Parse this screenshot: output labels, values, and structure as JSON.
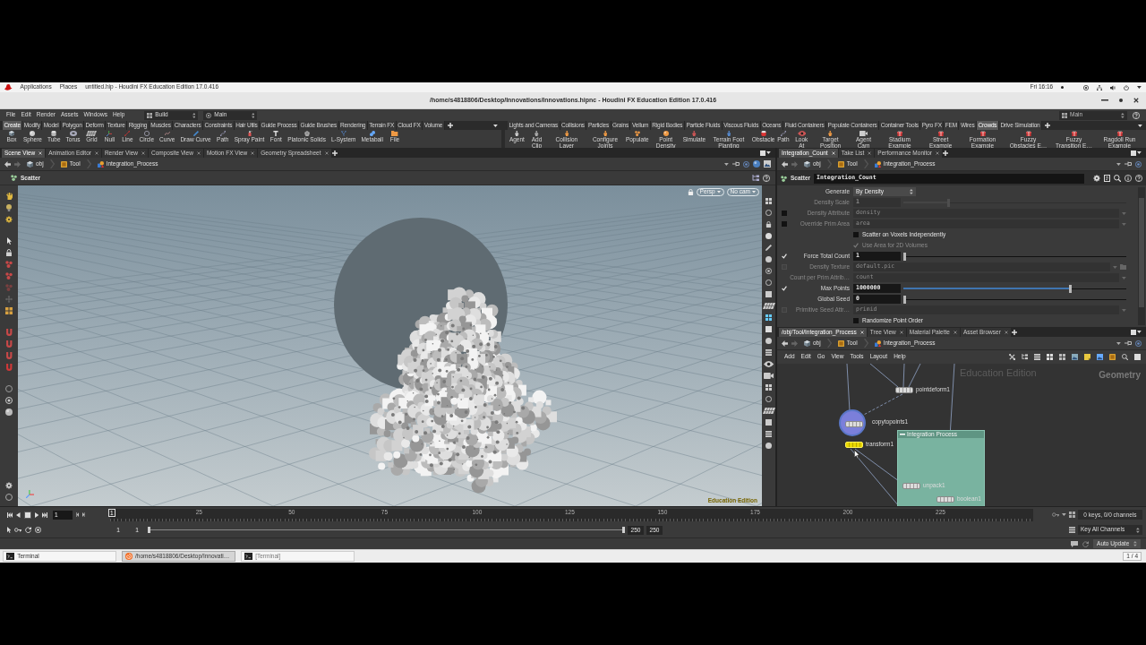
{
  "top_bar": {
    "menus": [
      "Applications",
      "Places"
    ],
    "active_window": "untitled.hip - Houdini FX Education Edition 17.0.416",
    "clock": "Fri 16:16"
  },
  "window": {
    "title": "/home/s4818806/Desktop/Innovations/Innovations.hipnc - Houdini FX Education Edition 17.0.416"
  },
  "menu_bar": {
    "items": [
      "File",
      "Edit",
      "Render",
      "Assets",
      "Windows",
      "Help"
    ],
    "desktop": "Build",
    "context": "Main",
    "right_context": "Main"
  },
  "shelves": [
    {
      "tabs": [
        {
          "label": "Create",
          "selected": true
        },
        {
          "label": "Modify",
          "selected": false
        },
        {
          "label": "Model",
          "selected": false
        },
        {
          "label": "Polygon",
          "selected": false
        },
        {
          "label": "Deform",
          "selected": false
        },
        {
          "label": "Texture",
          "selected": false
        },
        {
          "label": "Rigging",
          "selected": false
        },
        {
          "label": "Muscles",
          "selected": false
        },
        {
          "label": "Characters",
          "selected": false
        },
        {
          "label": "Constraints",
          "selected": false
        },
        {
          "label": "Hair Utils",
          "selected": false
        },
        {
          "label": "Guide Process",
          "selected": false
        },
        {
          "label": "Guide Brushes",
          "selected": false
        },
        {
          "label": "Rendering",
          "selected": false
        },
        {
          "label": "Terrain FX",
          "selected": false
        },
        {
          "label": "Cloud FX",
          "selected": false
        },
        {
          "label": "Volume",
          "selected": false
        }
      ],
      "tools": [
        "Box",
        "Sphere",
        "Tube",
        "Torus",
        "Grid",
        "Null",
        "Line",
        "Circle",
        "Curve",
        "Draw Curve",
        "Path",
        "Spray Paint",
        "Font",
        "Platonic Solids",
        "L-System",
        "Metaball",
        "File"
      ]
    },
    {
      "tabs": [
        {
          "label": "Lights and Cameras",
          "selected": false
        },
        {
          "label": "Collisions",
          "selected": false
        },
        {
          "label": "Particles",
          "selected": false
        },
        {
          "label": "Grains",
          "selected": false
        },
        {
          "label": "Vellum",
          "selected": false
        },
        {
          "label": "Rigid Bodies",
          "selected": false
        },
        {
          "label": "Particle Fluids",
          "selected": false
        },
        {
          "label": "Viscous Fluids",
          "selected": false
        },
        {
          "label": "Oceans",
          "selected": false
        },
        {
          "label": "Fluid Containers",
          "selected": false
        },
        {
          "label": "Populate Containers",
          "selected": false
        },
        {
          "label": "Container Tools",
          "selected": false
        },
        {
          "label": "Pyro FX",
          "selected": false
        },
        {
          "label": "FEM",
          "selected": false
        },
        {
          "label": "Wires",
          "selected": false
        },
        {
          "label": "Crowds",
          "selected": true
        },
        {
          "label": "Drive Simulation",
          "selected": false
        }
      ],
      "tools": [
        "Agent",
        "Add Clip",
        "Collision Layer",
        "Configure Joints",
        "Populate",
        "Point Density",
        "Simulate",
        "Terrain Foot Planting",
        "Obstacle",
        "Path",
        "Look At",
        "Target Position",
        "Agent Cam",
        "Stadium Example",
        "Street Example",
        "Formation Example",
        "Fuzzy Obstacles E…",
        "Fuzzy Transition E…",
        "Ragdoll Run Example"
      ]
    }
  ],
  "scene_pane": {
    "tabs": [
      {
        "label": "Scene View",
        "selected": true
      },
      {
        "label": "Animation Editor",
        "selected": false
      },
      {
        "label": "Render View",
        "selected": false
      },
      {
        "label": "Composite View",
        "selected": false
      },
      {
        "label": "Motion FX View",
        "selected": false
      },
      {
        "label": "Geometry Spreadsheet",
        "selected": false
      }
    ],
    "path": [
      "obj",
      "Tool",
      "Integration_Process"
    ],
    "viewport": {
      "title": "Scatter",
      "view": "Persp",
      "camera": "No cam",
      "watermark": "Education Edition"
    }
  },
  "parameter_pane": {
    "tabs": [
      {
        "label": "Integration_Count",
        "selected": true
      },
      {
        "label": "Take List",
        "selected": false
      },
      {
        "label": "Performance Monitor",
        "selected": false
      }
    ],
    "path": [
      "obj",
      "Tool",
      "Integration_Process"
    ],
    "node_type": "Scatter",
    "node_name": "Integration_Count",
    "parameters": [
      {
        "kind": "menu",
        "label": "Generate",
        "value": "By Density",
        "disabled": false
      },
      {
        "kind": "slider",
        "label": "Density Scale",
        "value": "1",
        "level": 0.2,
        "disabled": true
      },
      {
        "kind": "string",
        "label": "Density Attribute",
        "value": "density",
        "disabled": true,
        "toggle": {
          "checked": false,
          "disabled": false
        }
      },
      {
        "kind": "string",
        "label": "Override Prim Area",
        "value": "area",
        "disabled": true,
        "toggle": {
          "checked": false,
          "disabled": false
        }
      },
      {
        "kind": "checkbox",
        "label": "Scatter on Voxels Independently",
        "checked": false,
        "disabled": false
      },
      {
        "kind": "checkbox",
        "label": "Use Area for 2D Volumes",
        "checked": true,
        "disabled": true
      },
      {
        "kind": "slider",
        "label": "Force Total Count",
        "value": "1",
        "level": 0,
        "disabled": false,
        "toggle": {
          "checked": true,
          "disabled": false
        }
      },
      {
        "kind": "file",
        "label": "Density Texture",
        "value": "default.pic",
        "disabled": true,
        "toggle": {
          "checked": false,
          "disabled": true
        }
      },
      {
        "kind": "string",
        "label": "Count per Prim Attrib…",
        "value": "count",
        "disabled": true
      },
      {
        "kind": "slider",
        "label": "Max Points",
        "value": "1000000",
        "level": 0.75,
        "disabled": false,
        "toggle": {
          "checked": true,
          "disabled": false
        }
      },
      {
        "kind": "slider",
        "label": "Global Seed",
        "value": "0",
        "level": 0,
        "disabled": false
      },
      {
        "kind": "string",
        "label": "Primitive Seed Attr…",
        "value": "primid",
        "disabled": true,
        "toggle": {
          "checked": false,
          "disabled": true
        }
      },
      {
        "kind": "checkbox",
        "label": "Randomize Point Order",
        "checked": false,
        "disabled": false
      }
    ]
  },
  "network_pane": {
    "tabs": [
      {
        "label": "/obj/Tool/Integration_Process",
        "selected": true
      },
      {
        "label": "Tree View",
        "selected": false
      },
      {
        "label": "Material Palette",
        "selected": false
      },
      {
        "label": "Asset Browser",
        "selected": false
      }
    ],
    "path": [
      "obj",
      "Tool",
      "Integration_Process"
    ],
    "menus": [
      "Add",
      "Edit",
      "Go",
      "View",
      "Tools",
      "Layout",
      "Help"
    ],
    "watermark": "Education Edition",
    "context": "Geometry",
    "network_box": "Integration Process",
    "nodes": [
      {
        "name": "pointdeform1",
        "selected": false,
        "highlighted": false
      },
      {
        "name": "copytopoints1",
        "selected": false,
        "highlighted": true
      },
      {
        "name": "transform1",
        "selected": true,
        "highlighted": false
      },
      {
        "name": "unpack1",
        "selected": false,
        "highlighted": false
      },
      {
        "name": "boolean1",
        "selected": false,
        "highlighted": false
      }
    ]
  },
  "timeline": {
    "frame": "1",
    "marker": "1",
    "ruler_labels": [
      "25",
      "50",
      "75",
      "100",
      "125",
      "150",
      "175",
      "200",
      "225"
    ],
    "start": "1",
    "range_start": "1",
    "range_end": "250",
    "end": "250",
    "keys": "0 keys, 0/0 channels",
    "key_mode": "Key All Channels"
  },
  "status_bar": {
    "update_mode": "Auto Update"
  },
  "taskbar": {
    "items": [
      {
        "label": "Terminal",
        "selected": false,
        "minimized": false
      },
      {
        "label": "/home/s4818806/Desktop/Innovati…",
        "selected": true,
        "minimized": false
      },
      {
        "label": "[Terminal]",
        "selected": false,
        "minimized": true
      }
    ],
    "workspace": "1 / 4"
  }
}
